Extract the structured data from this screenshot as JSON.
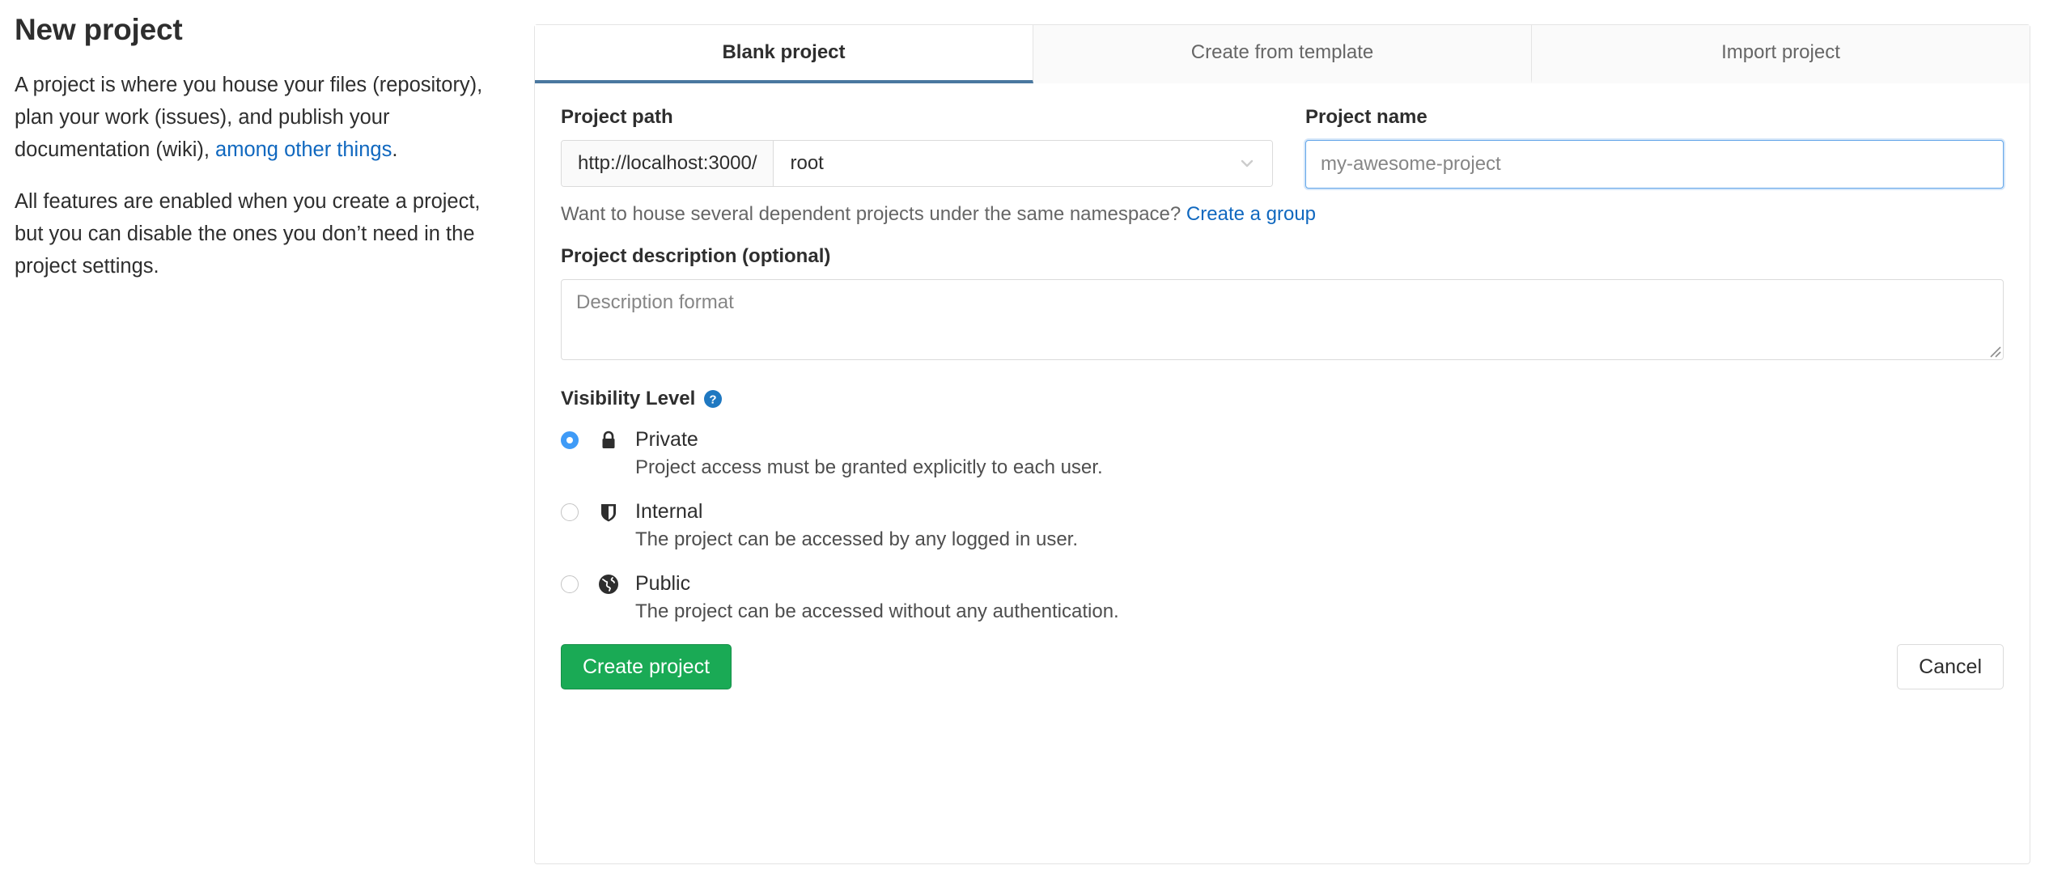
{
  "intro": {
    "title": "New project",
    "paragraph1_part1": "A project is where you house your files (repository), plan your work (issues), and publish your documentation (wiki), ",
    "paragraph1_link": "among other things",
    "paragraph1_part2": ".",
    "paragraph2": "All features are enabled when you create a project, but you can disable the ones you don’t need in the project settings."
  },
  "tabs": [
    {
      "label": "Blank project",
      "active": true
    },
    {
      "label": "Create from template",
      "active": false
    },
    {
      "label": "Import project",
      "active": false
    }
  ],
  "form": {
    "project_path_label": "Project path",
    "project_path_prefix": "http://localhost:3000/",
    "project_path_namespace": "root",
    "project_name_label": "Project name",
    "project_name_value": "",
    "project_name_placeholder": "my-awesome-project",
    "namespace_hint_text": "Want to house several dependent projects under the same namespace? ",
    "namespace_hint_link": "Create a group",
    "project_description_label": "Project description (optional)",
    "project_description_value": "",
    "project_description_placeholder": "Description format"
  },
  "visibility": {
    "title": "Visibility Level",
    "help_icon": "question-circle-icon",
    "options": [
      {
        "name": "Private",
        "description": "Project access must be granted explicitly to each user.",
        "icon": "lock-icon",
        "selected": true
      },
      {
        "name": "Internal",
        "description": "The project can be accessed by any logged in user.",
        "icon": "shield-icon",
        "selected": false
      },
      {
        "name": "Public",
        "description": "The project can be accessed without any authentication.",
        "icon": "globe-icon",
        "selected": false
      }
    ]
  },
  "actions": {
    "create_label": "Create project",
    "cancel_label": "Cancel"
  },
  "colors": {
    "link": "#1068bf",
    "active_tab_underline": "#4a789f",
    "primary_button": "#1aaa55",
    "radio_selected": "#3f9bf7",
    "help_icon": "#1f78c1",
    "focus_border": "#63a6e9"
  }
}
